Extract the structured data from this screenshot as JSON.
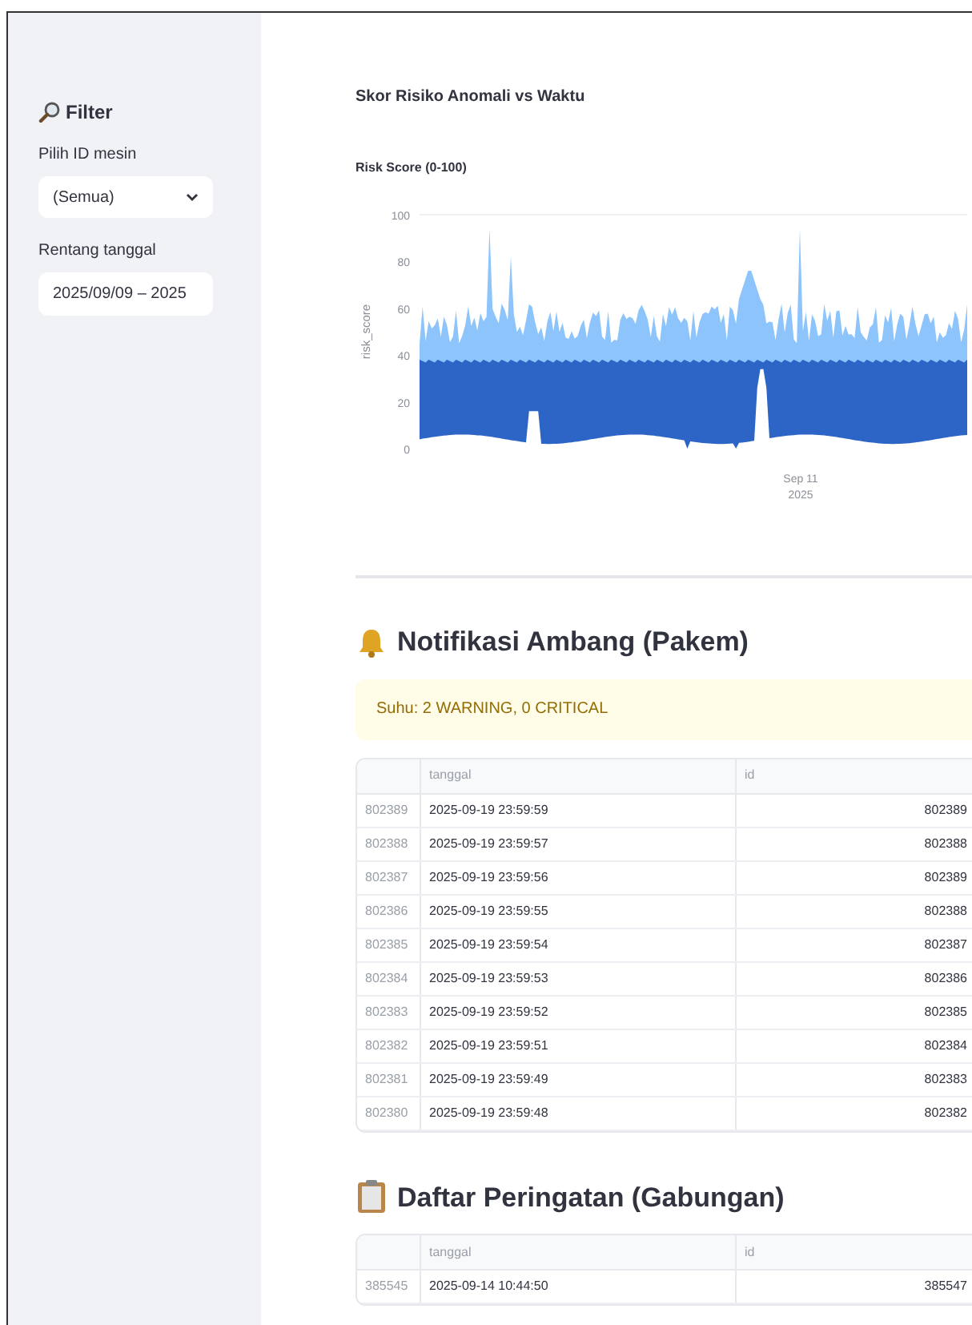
{
  "sidebar": {
    "title": "Filter",
    "machine_label": "Pilih ID mesin",
    "machine_value": "(Semua)",
    "date_label": "Rentang tanggal",
    "date_value": "2025/09/09 – 2025"
  },
  "chart_section": {
    "title": "Skor Risiko Anomali vs Waktu",
    "chart": {
      "title": "Risk Score (0-100)",
      "ylabel": "risk_score",
      "yticks": [
        "100",
        "80",
        "60",
        "40",
        "20",
        "0"
      ],
      "xtick": "Sep 11",
      "xtick_year": "2025"
    }
  },
  "notifications": {
    "heading": "Notifikasi Ambang (Pakem)",
    "alert": "Suhu: 2 WARNING, 0 CRITICAL",
    "columns": [
      "tanggal",
      "id"
    ],
    "rows": [
      {
        "index": "802389",
        "tanggal": "2025-09-19 23:59:59",
        "id": "802389"
      },
      {
        "index": "802388",
        "tanggal": "2025-09-19 23:59:57",
        "id": "802388"
      },
      {
        "index": "802387",
        "tanggal": "2025-09-19 23:59:56",
        "id": "802389"
      },
      {
        "index": "802386",
        "tanggal": "2025-09-19 23:59:55",
        "id": "802388"
      },
      {
        "index": "802385",
        "tanggal": "2025-09-19 23:59:54",
        "id": "802387"
      },
      {
        "index": "802384",
        "tanggal": "2025-09-19 23:59:53",
        "id": "802386"
      },
      {
        "index": "802383",
        "tanggal": "2025-09-19 23:59:52",
        "id": "802385"
      },
      {
        "index": "802382",
        "tanggal": "2025-09-19 23:59:51",
        "id": "802384"
      },
      {
        "index": "802381",
        "tanggal": "2025-09-19 23:59:49",
        "id": "802383"
      },
      {
        "index": "802380",
        "tanggal": "2025-09-19 23:59:48",
        "id": "802382"
      }
    ]
  },
  "warnings": {
    "heading": "Daftar Peringatan (Gabungan)",
    "columns": [
      "tanggal",
      "id"
    ],
    "rows": [
      {
        "index": "385545",
        "tanggal": "2025-09-14 10:44:50",
        "id": "385547"
      }
    ]
  }
}
